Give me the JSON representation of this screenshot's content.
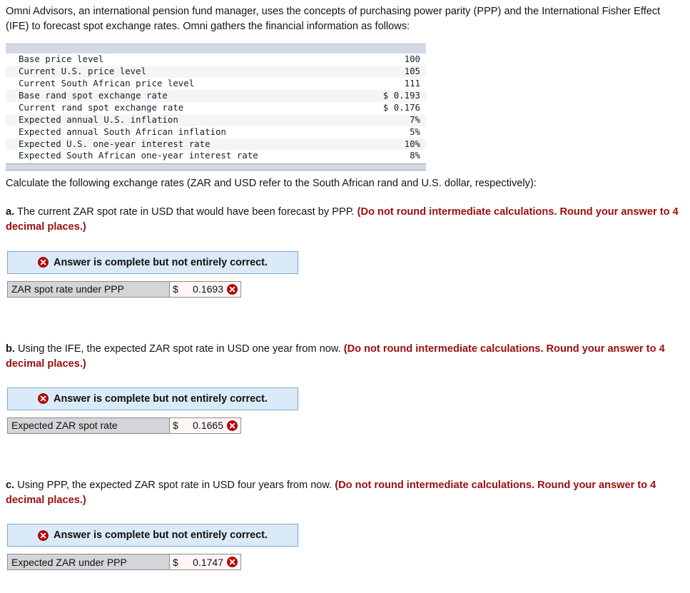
{
  "intro": {
    "paragraph": "Omni Advisors, an international pension fund manager, uses the concepts of purchasing power parity (PPP) and the International Fisher Effect (IFE) to forecast spot exchange rates. Omni gathers the financial information as follows:"
  },
  "facts_table": {
    "rows": [
      {
        "label": "Base price level",
        "value": "100"
      },
      {
        "label": "Current U.S. price level",
        "value": "105"
      },
      {
        "label": "Current South African price level",
        "value": "111"
      },
      {
        "label": "Base rand spot exchange rate",
        "value": "$ 0.193"
      },
      {
        "label": "Current rand spot exchange rate",
        "value": "$ 0.176"
      },
      {
        "label": "Expected annual U.S. inflation",
        "value": "7%"
      },
      {
        "label": "Expected annual South African inflation",
        "value": "5%"
      },
      {
        "label": "Expected U.S. one-year interest rate",
        "value": "10%"
      },
      {
        "label": "Expected South African one-year interest rate",
        "value": "8%"
      }
    ]
  },
  "calc_instruction": "Calculate the following exchange rates (ZAR and USD refer to the South African rand and U.S. dollar, respectively):",
  "questions": [
    {
      "letter": "a.",
      "text": " The current ZAR spot rate in USD that would have been forecast by PPP. ",
      "note": "(Do not round intermediate calculations. Round your answer to 4 decimal places.)",
      "status": "Answer is complete but not entirely correct.",
      "answer_label": "ZAR spot rate under PPP",
      "currency_symbol": "$",
      "answer_value": "0.1693"
    },
    {
      "letter": "b.",
      "text": " Using the IFE, the expected ZAR spot rate in USD one year from now. ",
      "note": "(Do not round intermediate calculations. Round your answer to 4 decimal places.)",
      "status": "Answer is complete but not entirely correct.",
      "answer_label": "Expected ZAR spot rate",
      "currency_symbol": "$",
      "answer_value": "0.1665"
    },
    {
      "letter": "c.",
      "text": " Using PPP, the expected ZAR spot rate in USD four years from now. ",
      "note": "(Do not round intermediate calculations. Round your answer to 4 decimal places.)",
      "status": "Answer is complete but not entirely correct.",
      "answer_label": "Expected ZAR under PPP",
      "currency_symbol": "$",
      "answer_value": "0.1747"
    }
  ],
  "icons": {
    "error": "error-x-circle-icon"
  },
  "colors": {
    "note_red": "#9c0d0d",
    "banner_bg": "#dbeaf8",
    "banner_border": "#7ba7cc",
    "error_red": "#c00000",
    "table_bar": "#d4dae5",
    "label_cell_bg": "#d4d4d9",
    "value_cell_bg": "#fdf6f5"
  }
}
